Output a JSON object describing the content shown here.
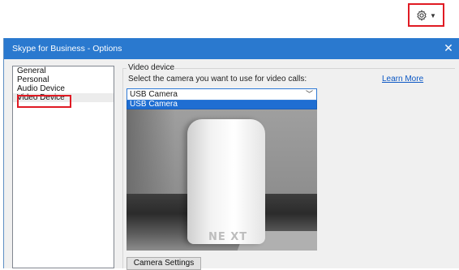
{
  "header": {
    "settings_icon": "gear-icon",
    "dropdown_icon": "caret-down-icon",
    "highlight_color": "#e01b24"
  },
  "dialog": {
    "title": "Skype for Business - Options",
    "close_icon": "close-icon",
    "titlebar_color": "#2a79cf"
  },
  "nav": {
    "items": [
      {
        "label": "General"
      },
      {
        "label": "Personal"
      },
      {
        "label": "Audio Device"
      },
      {
        "label": "Video Device",
        "selected": true
      }
    ]
  },
  "video": {
    "section_label": "Video device",
    "prompt": "Select the camera you want to use for video calls:",
    "learn_more": "Learn More",
    "selected_camera": "USB Camera",
    "options": [
      "USB Camera"
    ],
    "preview_logo": "NE XT",
    "camera_settings_label": "Camera Settings"
  }
}
